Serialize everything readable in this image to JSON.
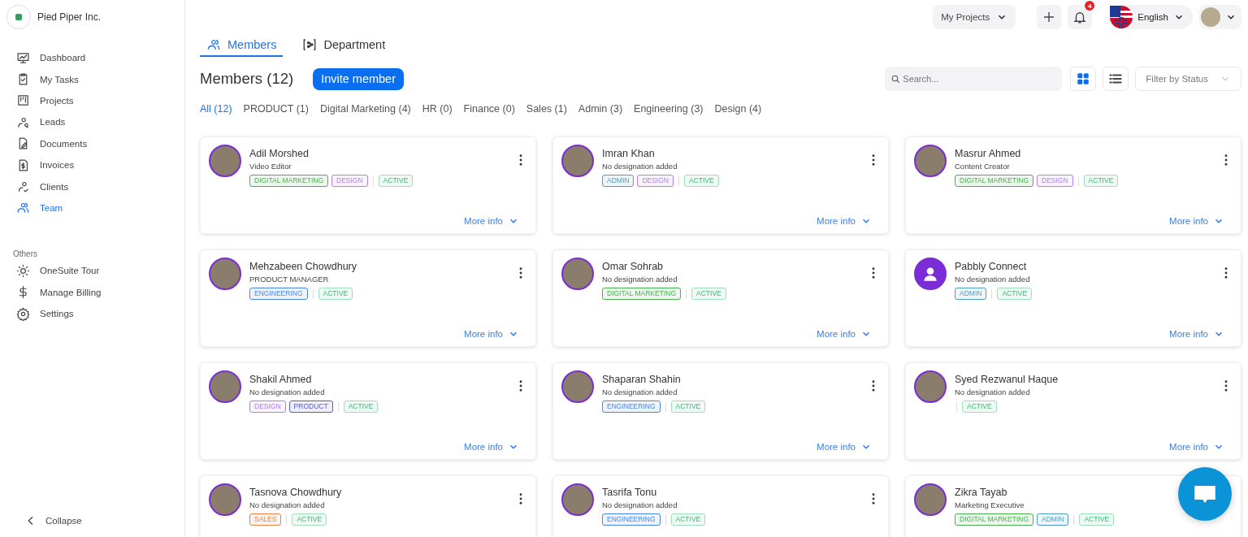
{
  "company": {
    "name": "Pied Piper Inc."
  },
  "sidebar": {
    "items": [
      {
        "label": "Dashboard",
        "selected": false
      },
      {
        "label": "My Tasks",
        "selected": false
      },
      {
        "label": "Projects",
        "selected": false
      },
      {
        "label": "Leads",
        "selected": false
      },
      {
        "label": "Documents",
        "selected": false
      },
      {
        "label": "Invoices",
        "selected": false
      },
      {
        "label": "Clients",
        "selected": false
      },
      {
        "label": "Team",
        "selected": true
      }
    ],
    "others_heading": "Others",
    "others": [
      {
        "label": "OneSuite Tour"
      },
      {
        "label": "Manage Billing"
      },
      {
        "label": "Settings"
      }
    ],
    "collapse": "Collapse"
  },
  "topbar": {
    "projects": "My Projects",
    "notifications": "4",
    "language": "English"
  },
  "tabs": [
    {
      "label": "Members",
      "selected": true
    },
    {
      "label": "Department",
      "selected": false
    }
  ],
  "heading": "Members (12)",
  "invite": "Invite member",
  "search": {
    "placeholder": "Search..."
  },
  "view_toggle": [
    {
      "kind": "grid",
      "selected": true
    },
    {
      "kind": "list",
      "selected": false
    }
  ],
  "status_filter": "Filter by Status",
  "filters": [
    {
      "label": "All (12)",
      "selected": true
    },
    {
      "label": "PRODUCT (1)",
      "selected": false
    },
    {
      "label": "Digital Marketing (4)",
      "selected": false
    },
    {
      "label": "HR (0)",
      "selected": false
    },
    {
      "label": "Finance (0)",
      "selected": false
    },
    {
      "label": "Sales (1)",
      "selected": false
    },
    {
      "label": "Admin (3)",
      "selected": false
    },
    {
      "label": "Engineering (3)",
      "selected": false
    },
    {
      "label": "Design (4)",
      "selected": false
    }
  ],
  "members": [
    {
      "name": "Adil Morshed",
      "designation": "Video Editor",
      "kind": "photo",
      "tags": [
        {
          "label": "DIGITAL MARKETING",
          "color": "#4caf50"
        },
        {
          "label": "DESIGN",
          "color": "#b27ef0"
        }
      ],
      "status": "ACTIVE",
      "more_info": "More info"
    },
    {
      "name": "Imran Khan",
      "designation": "No designation added",
      "kind": "photo",
      "tags": [
        {
          "label": "ADMIN",
          "color": "#4f9cc4"
        },
        {
          "label": "DESIGN",
          "color": "#b27ef0"
        }
      ],
      "status": "ACTIVE",
      "more_info": "More info"
    },
    {
      "name": "Masrur Ahmed",
      "designation": "Content Creator",
      "kind": "photo",
      "tags": [
        {
          "label": "DIGITAL MARKETING",
          "color": "#4caf50"
        },
        {
          "label": "DESIGN",
          "color": "#b27ef0"
        }
      ],
      "status": "ACTIVE",
      "more_info": "More info"
    },
    {
      "name": "Mehzabeen Chowdhury",
      "designation": "PRODUCT MANAGER",
      "kind": "photo",
      "tags": [
        {
          "label": "ENGINEERING",
          "color": "#4a86e8"
        }
      ],
      "status": "ACTIVE",
      "more_info": "More info"
    },
    {
      "name": "Omar Sohrab",
      "designation": "No designation added",
      "kind": "photo",
      "tags": [
        {
          "label": "DIGITAL MARKETING",
          "color": "#4caf50"
        }
      ],
      "status": "ACTIVE",
      "more_info": "More info"
    },
    {
      "name": "Pabbly Connect",
      "designation": "No designation added",
      "kind": "generic",
      "tags": [
        {
          "label": "ADMIN",
          "color": "#4f9cc4"
        }
      ],
      "status": "ACTIVE",
      "more_info": "More info"
    },
    {
      "name": "Shakil Ahmed",
      "designation": "No designation added",
      "kind": "photo",
      "tags": [
        {
          "label": "DESIGN",
          "color": "#b27ef0"
        },
        {
          "label": "PRODUCT",
          "color": "#5457e0"
        }
      ],
      "status": "ACTIVE",
      "more_info": "More info"
    },
    {
      "name": "Shaparan Shahin",
      "designation": "No designation added",
      "kind": "photo",
      "tags": [
        {
          "label": "ENGINEERING",
          "color": "#4a86e8"
        }
      ],
      "status": "ACTIVE",
      "more_info": "More info"
    },
    {
      "name": "Syed Rezwanul Haque",
      "designation": "No designation added",
      "kind": "photo",
      "status": "ACTIVE",
      "more_info": "More info"
    },
    {
      "name": "Tasnova Chowdhury",
      "designation": "No designation added",
      "kind": "photo",
      "tags": [
        {
          "label": "SALES",
          "color": "#e8844a"
        }
      ],
      "status": "ACTIVE"
    },
    {
      "name": "Tasrifa Tonu",
      "designation": "No designation added",
      "kind": "photo",
      "tags": [
        {
          "label": "ENGINEERING",
          "color": "#4a86e8"
        }
      ],
      "status": "ACTIVE"
    },
    {
      "name": "Zikra Tayab",
      "designation": "Marketing Executive",
      "kind": "photo",
      "tags": [
        {
          "label": "DIGITAL MARKETING",
          "color": "#4caf50"
        },
        {
          "label": "ADMIN",
          "color": "#4f9cc4"
        }
      ],
      "status": "ACTIVE",
      "menu": false
    }
  ]
}
